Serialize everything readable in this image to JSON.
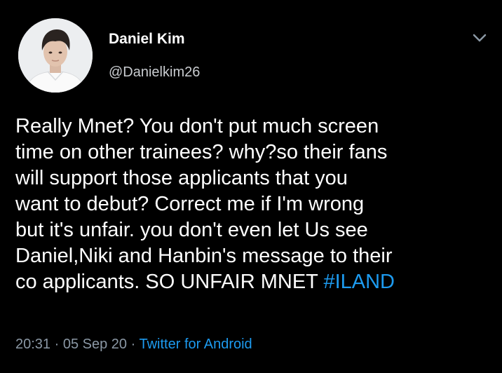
{
  "tweet": {
    "author": {
      "display_name": "Daniel Kim",
      "handle": "@Danielkim26",
      "avatar_icon": "avatar-photo"
    },
    "menu_icon": "chevron-down-icon",
    "body_lines": [
      "Really Mnet? You don't put much screen",
      "time on other trainees? why?so their fans",
      "will support those applicants that you",
      "want to debut? Correct me if I'm wrong",
      "but it's unfair. you don't even let Us see",
      "Daniel,Niki and Hanbin's message to their",
      "co applicants. SO UNFAIR MNET "
    ],
    "hashtag": "#ILAND",
    "time": "20:31",
    "separator": "·",
    "date": "05 Sep 20",
    "source": "Twitter for Android"
  },
  "colors": {
    "background": "#000000",
    "text": "#ffffff",
    "muted": "#8b98a5",
    "accent": "#1d9bf0"
  }
}
